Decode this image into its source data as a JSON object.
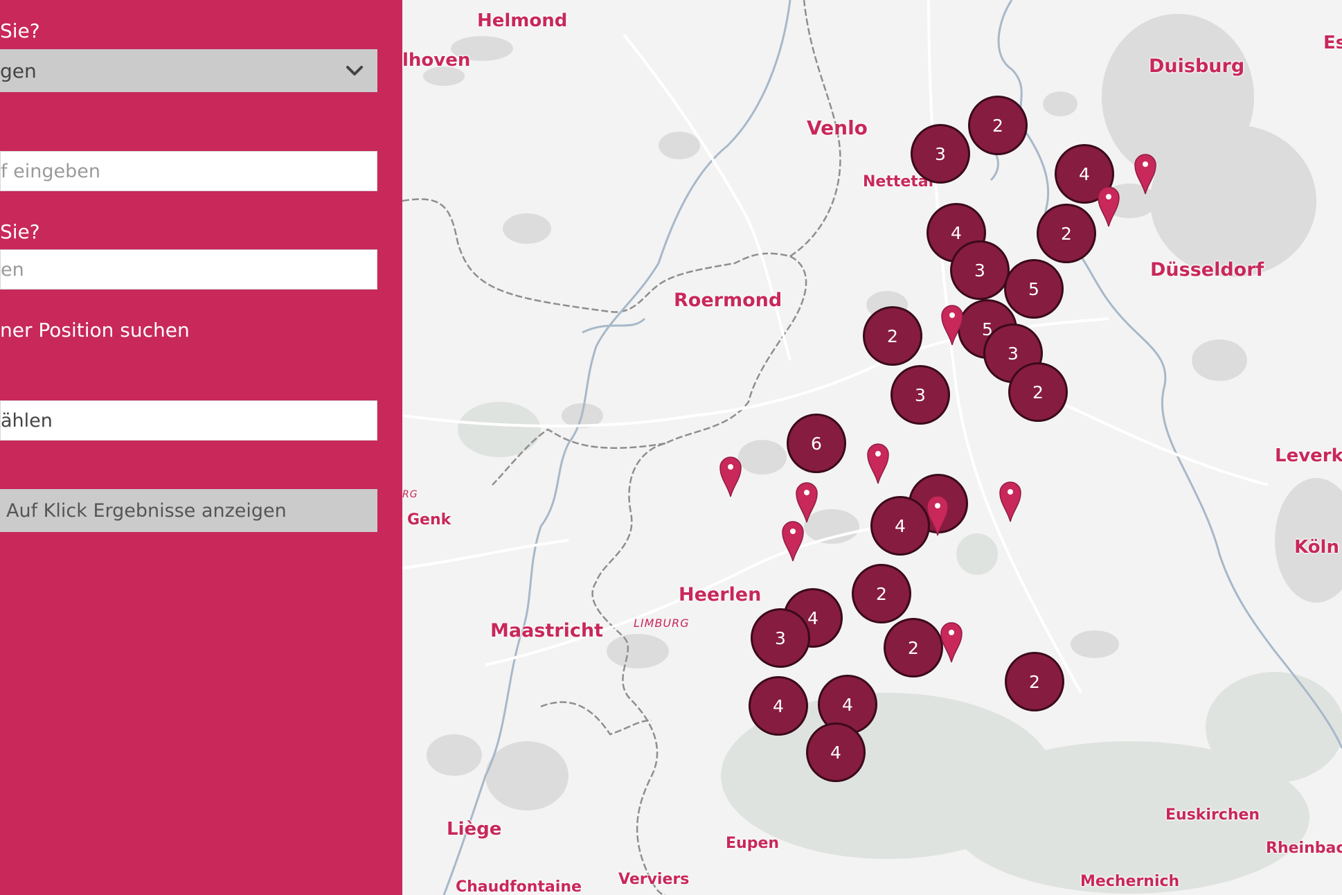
{
  "sidebar": {
    "q1_label": "Sie?",
    "q1_select_value": "gen",
    "q2_placeholder": "f eingeben",
    "q3_label": "Sie?",
    "q3_placeholder": "en",
    "position_label": "ner Position suchen",
    "select2_value": "ählen",
    "results_button": "Auf Klick Ergebnisse anzeigen"
  },
  "map": {
    "cities": [
      "Helmond",
      "lhoven",
      "Venlo",
      "Nettetal",
      "Duisburg",
      "Es",
      "Düsseldorf",
      "Roermond",
      "Leverk",
      "Genk",
      "Heerlen",
      "Maastricht",
      "Köln",
      "Liège",
      "Eupen",
      "Euskirchen",
      "Rheinbac",
      "Chaudfontaine",
      "Verviers",
      "Mechernich"
    ],
    "regions": [
      "LIMBURG",
      "RG"
    ],
    "clusters": [
      "2",
      "3",
      "4",
      "4",
      "2",
      "3",
      "5",
      "5",
      "2",
      "3",
      "3",
      "2",
      "6",
      "",
      "4",
      "2",
      "4",
      "3",
      "2",
      "2",
      "4",
      "4",
      "4"
    ],
    "accent": "#c8285a",
    "cluster_color": "#861c40"
  }
}
